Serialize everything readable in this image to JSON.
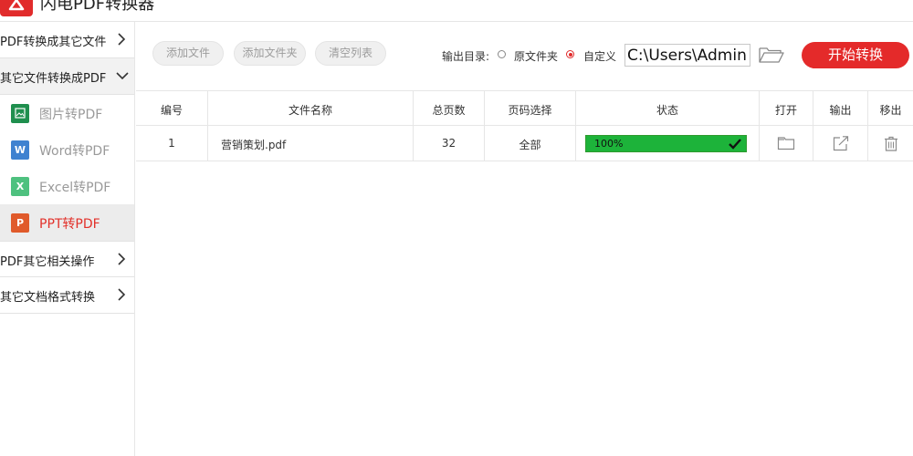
{
  "app": {
    "title": "闪电PDF转换器",
    "brand_color": "#e12b2b"
  },
  "sidebar": {
    "categories": [
      {
        "label": "PDF转换成其它文件",
        "expanded": false
      },
      {
        "label": "其它文件转换成PDF",
        "expanded": true,
        "items": [
          {
            "label": "图片转PDF",
            "icon": "image-file-icon",
            "color": "#1f8f4e",
            "glyph": "▨",
            "active": false
          },
          {
            "label": "Word转PDF",
            "icon": "word-file-icon",
            "color": "#3f82d0",
            "glyph": "W",
            "active": false
          },
          {
            "label": "Excel转PDF",
            "icon": "excel-file-icon",
            "color": "#4ec17f",
            "glyph": "X",
            "active": false
          },
          {
            "label": "PPT转PDF",
            "icon": "ppt-file-icon",
            "color": "#e05a2b",
            "glyph": "P",
            "active": true
          }
        ]
      },
      {
        "label": "PDF其它相关操作",
        "expanded": false
      },
      {
        "label": "其它文档格式转换",
        "expanded": false
      }
    ]
  },
  "toolbar": {
    "add_file": "添加文件",
    "add_folder": "添加文件夹",
    "clear_list": "清空列表",
    "output_dir_label": "输出目录:",
    "option_source_folder": "原文件夹",
    "option_custom": "自定义",
    "selected_option": "自定义",
    "output_path": "C:\\Users\\Administrator\\Desktop",
    "start_button": "开始转换"
  },
  "table": {
    "headers": {
      "index": "编号",
      "filename": "文件名称",
      "pages": "总页数",
      "page_select": "页码选择",
      "status": "状态",
      "open": "打开",
      "output": "输出",
      "remove": "移出"
    },
    "rows": [
      {
        "index": "1",
        "filename": "营销策划.pdf",
        "pages": "32",
        "page_select": "全部",
        "status_text": "100%",
        "progress": 1.0,
        "status_color": "#1db33a"
      }
    ]
  }
}
